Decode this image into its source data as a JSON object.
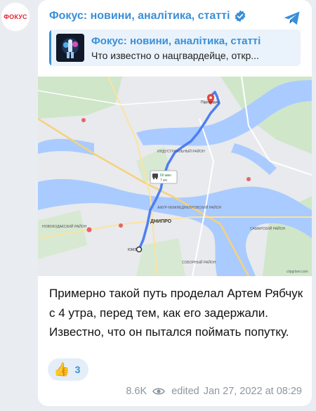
{
  "channel": {
    "avatar_text": "ФОКУС",
    "name": "Фокус: новини, аналітика, статті"
  },
  "forwarded": {
    "title": "Фокус: новини, аналітика, статті",
    "preview": "Что известно о нацгвардейце, откр..."
  },
  "map": {
    "labels": {
      "pidhorodne": "Підгородне",
      "travel_time": "60 мин",
      "travel_dist": "7 км",
      "district_industrial": "ИНДУСТРИАЛЬНЫЙ РАЙОН",
      "city": "ДНИПРО",
      "district_novokodatsky": "НОВОКОДАКСКИЙ РАЙОН",
      "district_sobornyi": "СОБОРНЫЙ РАЙОН",
      "district_amur": "АМУР-НИЖНЕДНЕПРОВСКИЙ РАЙОН",
      "district_samarsky": "САМАРСКИЙ РАЙОН",
      "start_place": "ЮМЗ",
      "watermark": "clipgrlset.com"
    }
  },
  "message": {
    "text": "Примерно такой путь проделал Артем Рябчук с 4 утра, перед тем, как его задержали. Известно, что он пытался поймать попутку."
  },
  "reaction": {
    "emoji": "👍",
    "count": "3"
  },
  "footer": {
    "views": "8.6K",
    "status": "edited",
    "datetime": "Jan 27, 2022 at 08:29"
  },
  "colors": {
    "accent": "#3a8fd8",
    "brand_red": "#e3262f",
    "route": "#4f7ff0",
    "water": "#aacbff"
  }
}
